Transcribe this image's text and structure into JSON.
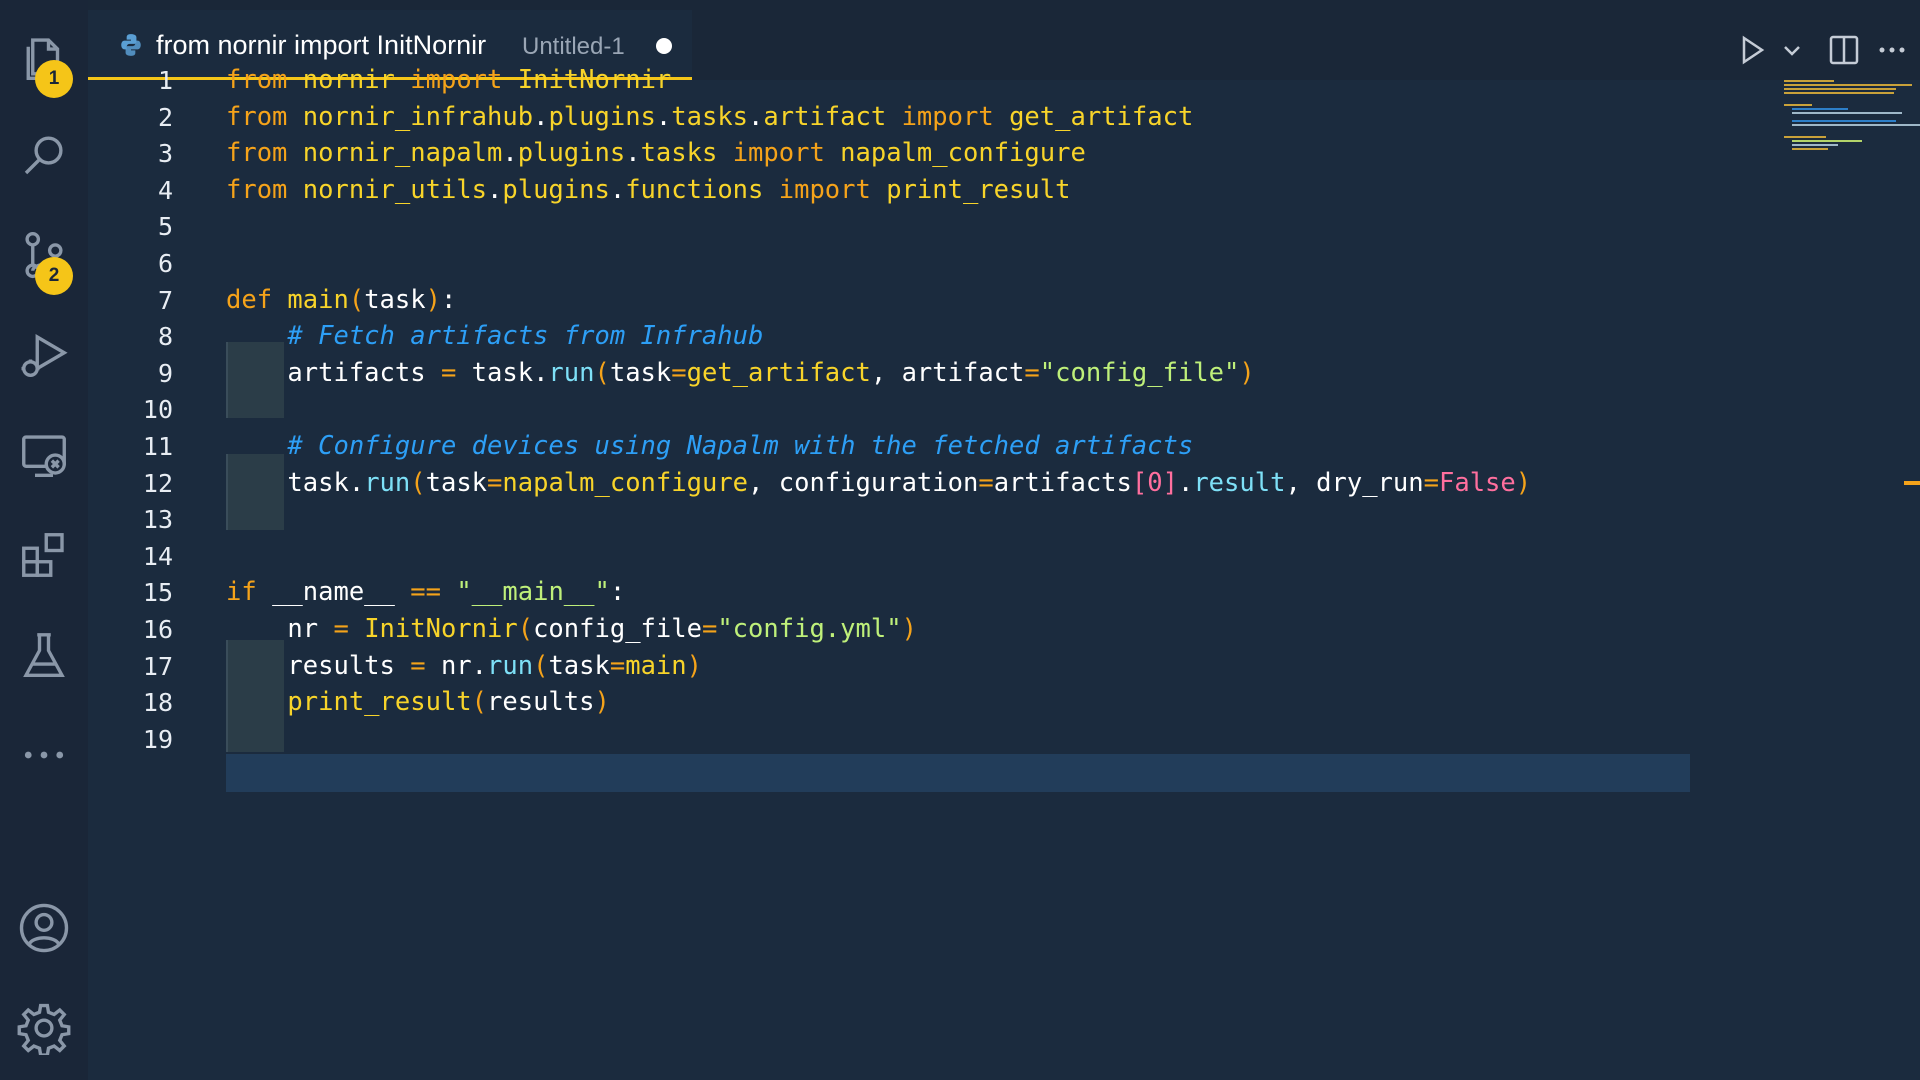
{
  "tab": {
    "title": "from nornir import InitNornir",
    "subtitle": "Untitled-1",
    "icon": "python-icon"
  },
  "activity_bar": {
    "items": [
      {
        "name": "explorer",
        "icon": "files-icon",
        "badge": "1"
      },
      {
        "name": "search",
        "icon": "search-icon"
      },
      {
        "name": "source-control",
        "icon": "source-control-icon",
        "badge": "2"
      },
      {
        "name": "run-and-debug",
        "icon": "run-debug-icon"
      },
      {
        "name": "remote-explorer",
        "icon": "remote-explorer-icon"
      },
      {
        "name": "extensions",
        "icon": "extensions-icon"
      },
      {
        "name": "testing",
        "icon": "flask-icon"
      },
      {
        "name": "more",
        "icon": "more-icon"
      },
      {
        "name": "accounts",
        "icon": "account-icon"
      },
      {
        "name": "manage",
        "icon": "gear-icon"
      }
    ]
  },
  "editor_actions": [
    "run-icon",
    "chevron-down-icon",
    "split-editor-icon",
    "more-actions-icon"
  ],
  "colors": {
    "background": "#1b2b3e",
    "accent": "#f5c518",
    "keyword": "#f5a31a",
    "function": "#f8d42a",
    "string": "#bff07a",
    "comment": "#2d9ff6",
    "boolean": "#ff6f9e"
  },
  "code": {
    "current_line": 19,
    "line_numbers": [
      "1",
      "2",
      "3",
      "4",
      "5",
      "6",
      "7",
      "8",
      "9",
      "10",
      "11",
      "12",
      "13",
      "14",
      "15",
      "16",
      "17",
      "18",
      "19"
    ],
    "lines": [
      [
        [
          "kw",
          "from"
        ],
        [
          "plain",
          " "
        ],
        [
          "mod",
          "nornir"
        ],
        [
          "plain",
          " "
        ],
        [
          "kw",
          "import"
        ],
        [
          "plain",
          " "
        ],
        [
          "fn",
          "InitNornir"
        ]
      ],
      [
        [
          "kw",
          "from"
        ],
        [
          "plain",
          " "
        ],
        [
          "mod",
          "nornir_infrahub"
        ],
        [
          "punc",
          "."
        ],
        [
          "mod",
          "plugins"
        ],
        [
          "punc",
          "."
        ],
        [
          "mod",
          "tasks"
        ],
        [
          "punc",
          "."
        ],
        [
          "mod",
          "artifact"
        ],
        [
          "plain",
          " "
        ],
        [
          "kw",
          "import"
        ],
        [
          "plain",
          " "
        ],
        [
          "fn",
          "get_artifact"
        ]
      ],
      [
        [
          "kw",
          "from"
        ],
        [
          "plain",
          " "
        ],
        [
          "mod",
          "nornir_napalm"
        ],
        [
          "punc",
          "."
        ],
        [
          "mod",
          "plugins"
        ],
        [
          "punc",
          "."
        ],
        [
          "mod",
          "tasks"
        ],
        [
          "plain",
          " "
        ],
        [
          "kw",
          "import"
        ],
        [
          "plain",
          " "
        ],
        [
          "fn",
          "napalm_configure"
        ]
      ],
      [
        [
          "kw",
          "from"
        ],
        [
          "plain",
          " "
        ],
        [
          "mod",
          "nornir_utils"
        ],
        [
          "punc",
          "."
        ],
        [
          "mod",
          "plugins"
        ],
        [
          "punc",
          "."
        ],
        [
          "mod",
          "functions"
        ],
        [
          "plain",
          " "
        ],
        [
          "kw",
          "import"
        ],
        [
          "plain",
          " "
        ],
        [
          "fn",
          "print_result"
        ]
      ],
      [],
      [],
      [
        [
          "kw",
          "def"
        ],
        [
          "plain",
          " "
        ],
        [
          "fn",
          "main"
        ],
        [
          "paren",
          "("
        ],
        [
          "plain",
          "task"
        ],
        [
          "paren",
          ")"
        ],
        [
          "punc",
          ":"
        ]
      ],
      [
        [
          "plain",
          "    "
        ],
        [
          "cmt",
          "# Fetch artifacts from Infrahub"
        ]
      ],
      [
        [
          "plain",
          "    artifacts "
        ],
        [
          "op",
          "="
        ],
        [
          "plain",
          " task"
        ],
        [
          "punc",
          "."
        ],
        [
          "attr",
          "run"
        ],
        [
          "paren",
          "("
        ],
        [
          "plain",
          "task"
        ],
        [
          "op",
          "="
        ],
        [
          "fn",
          "get_artifact"
        ],
        [
          "punc",
          ", "
        ],
        [
          "plain",
          "artifact"
        ],
        [
          "op",
          "="
        ],
        [
          "str",
          "\"config_file\""
        ],
        [
          "paren",
          ")"
        ]
      ],
      [],
      [
        [
          "plain",
          "    "
        ],
        [
          "cmt",
          "# Configure devices using Napalm with the fetched artifacts"
        ]
      ],
      [
        [
          "plain",
          "    task"
        ],
        [
          "punc",
          "."
        ],
        [
          "attr",
          "run"
        ],
        [
          "paren",
          "("
        ],
        [
          "plain",
          "task"
        ],
        [
          "op",
          "="
        ],
        [
          "fn",
          "napalm_configure"
        ],
        [
          "punc",
          ", "
        ],
        [
          "plain",
          "configuration"
        ],
        [
          "op",
          "="
        ],
        [
          "plain",
          "artifacts"
        ],
        [
          "bracket",
          "["
        ],
        [
          "num",
          "0"
        ],
        [
          "bracket",
          "]"
        ],
        [
          "punc",
          "."
        ],
        [
          "attr",
          "result"
        ],
        [
          "punc",
          ", "
        ],
        [
          "plain",
          "dry_run"
        ],
        [
          "op",
          "="
        ],
        [
          "bool",
          "False"
        ],
        [
          "paren",
          ")"
        ]
      ],
      [],
      [],
      [
        [
          "kw",
          "if"
        ],
        [
          "plain",
          " __name__ "
        ],
        [
          "op",
          "=="
        ],
        [
          "plain",
          " "
        ],
        [
          "str",
          "\"__main__\""
        ],
        [
          "punc",
          ":"
        ]
      ],
      [
        [
          "plain",
          "    nr "
        ],
        [
          "op",
          "="
        ],
        [
          "plain",
          " "
        ],
        [
          "fn",
          "InitNornir"
        ],
        [
          "paren",
          "("
        ],
        [
          "plain",
          "config_file"
        ],
        [
          "op",
          "="
        ],
        [
          "str",
          "\"config.yml\""
        ],
        [
          "paren",
          ")"
        ]
      ],
      [
        [
          "plain",
          "    results "
        ],
        [
          "op",
          "="
        ],
        [
          "plain",
          " nr"
        ],
        [
          "punc",
          "."
        ],
        [
          "attr",
          "run"
        ],
        [
          "paren",
          "("
        ],
        [
          "plain",
          "task"
        ],
        [
          "op",
          "="
        ],
        [
          "fn",
          "main"
        ],
        [
          "paren",
          ")"
        ]
      ],
      [
        [
          "plain",
          "    "
        ],
        [
          "fn",
          "print_result"
        ],
        [
          "paren",
          "("
        ],
        [
          "plain",
          "results"
        ],
        [
          "paren",
          ")"
        ]
      ],
      []
    ]
  }
}
